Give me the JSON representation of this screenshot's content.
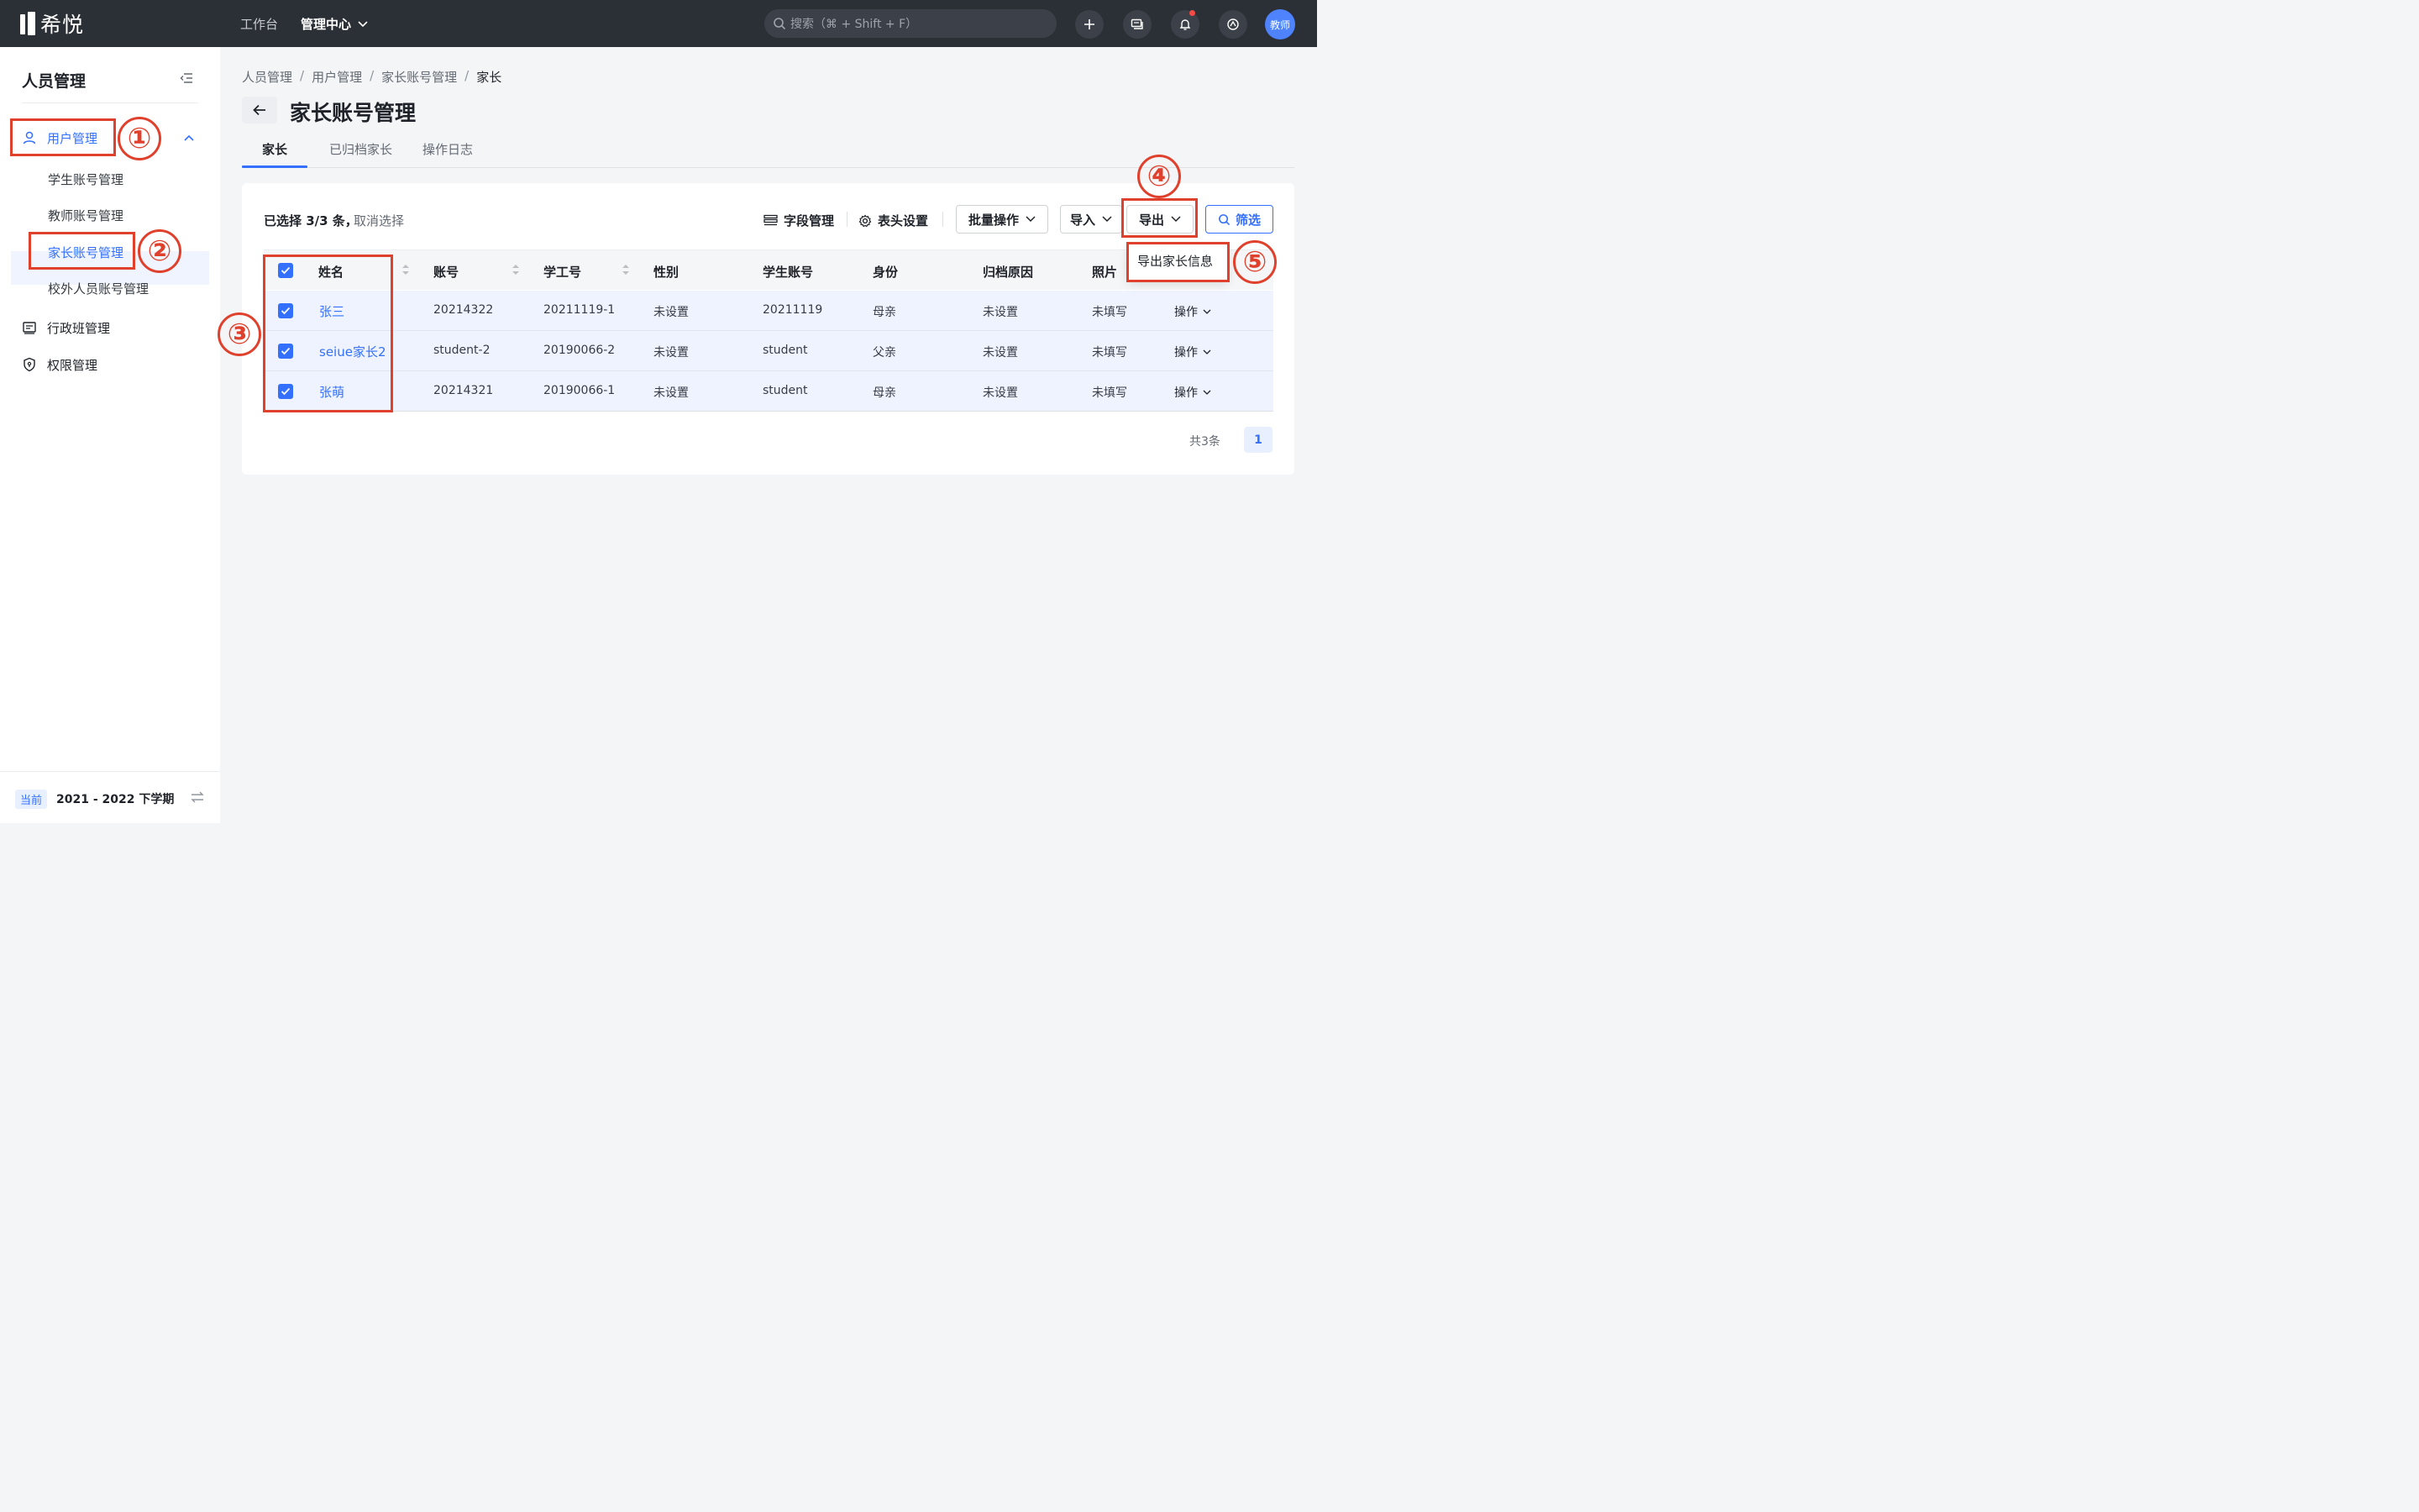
{
  "topbar": {
    "logo_text": "希悦",
    "nav_workbench": "工作台",
    "nav_admin": "管理中心",
    "search_placeholder": "搜索（⌘ + Shift + F）",
    "avatar_text": "教师",
    "icons": [
      "plus-icon",
      "message-icon",
      "bell-icon",
      "app-switch-icon"
    ],
    "notification_dot_color": "#f54a45"
  },
  "sidebar": {
    "title": "人员管理",
    "items": [
      {
        "label": "用户管理",
        "icon": "user-icon",
        "expanded": true
      },
      {
        "label": "学生账号管理"
      },
      {
        "label": "教师账号管理"
      },
      {
        "label": "家长账号管理",
        "active": true
      },
      {
        "label": "校外人员账号管理"
      },
      {
        "label": "行政班管理",
        "icon": "class-icon"
      },
      {
        "label": "权限管理",
        "icon": "shield-icon"
      }
    ],
    "term_badge": "当前",
    "term_text": "2021 - 2022 下学期"
  },
  "breadcrumb": [
    "人员管理",
    "用户管理",
    "家长账号管理",
    "家长"
  ],
  "breadcrumb_sep": "/",
  "page_title": "家长账号管理",
  "tabs": [
    "家长",
    "已归档家长",
    "操作日志"
  ],
  "toolbar": {
    "selection_info": "已选择 3/3 条，",
    "cancel_selection": "取消选择",
    "field_manage": "字段管理",
    "header_settings": "表头设置",
    "batch_ops": "批量操作",
    "import": "导入",
    "export": "导出",
    "filter": "筛选"
  },
  "export_menu": [
    "导出家长信息"
  ],
  "table": {
    "columns": [
      "姓名",
      "账号",
      "学工号",
      "性别",
      "学生账号",
      "身份",
      "归档原因",
      "照片"
    ],
    "rows": [
      {
        "name": "张三",
        "account": "20214322",
        "staff_no": "20211119-1",
        "gender": "未设置",
        "student_account": "20211119",
        "identity": "母亲",
        "archive_reason": "未设置",
        "photo": "未填写",
        "op": "操作"
      },
      {
        "name": "seiue家长2",
        "account": "student-2",
        "staff_no": "20190066-2",
        "gender": "未设置",
        "student_account": "student",
        "identity": "父亲",
        "archive_reason": "未设置",
        "photo": "未填写",
        "op": "操作"
      },
      {
        "name": "张萌",
        "account": "20214321",
        "staff_no": "20190066-1",
        "gender": "未设置",
        "student_account": "student",
        "identity": "母亲",
        "archive_reason": "未设置",
        "photo": "未填写",
        "op": "操作"
      }
    ]
  },
  "pagination": {
    "total": "共3条",
    "current": "1"
  },
  "annotations": {
    "color": "#e0412d",
    "labels": [
      "①",
      "②",
      "③",
      "④",
      "⑤"
    ]
  },
  "colors": {
    "accent": "#3370ff",
    "topbar": "#2b2f36"
  }
}
